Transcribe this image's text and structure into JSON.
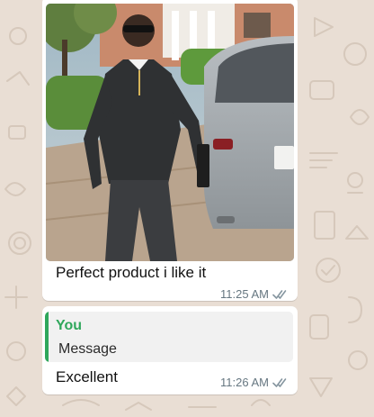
{
  "colors": {
    "wallpaper": "#e9ded4",
    "bubble": "#ffffff",
    "quote_accent": "#2fa75b",
    "timestamp": "#667781"
  },
  "messages": [
    {
      "type": "image",
      "image_description_icon": "photo-image",
      "caption": "Perfect product i like it",
      "time": "11:25 AM",
      "status_icon": "double-check-icon"
    },
    {
      "type": "reply",
      "quoted": {
        "author": "You",
        "text": "Message"
      },
      "text": "Excellent",
      "time": "11:26 AM",
      "status_icon": "double-check-icon"
    }
  ]
}
